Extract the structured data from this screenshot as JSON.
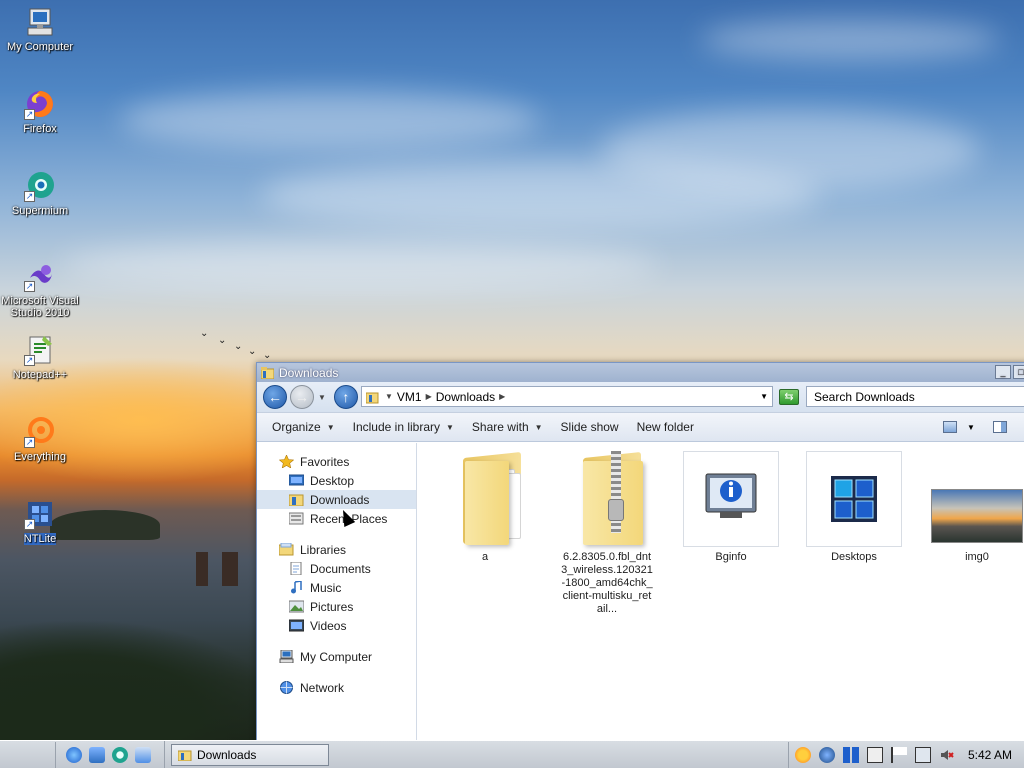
{
  "desktop": {
    "icons": [
      {
        "label": "My Computer",
        "icon": "computer-icon"
      },
      {
        "label": "Firefox",
        "icon": "firefox-icon"
      },
      {
        "label": "Supermium",
        "icon": "supermium-icon"
      },
      {
        "label": "Microsoft Visual Studio 2010",
        "icon": "visual-studio-icon"
      },
      {
        "label": "Notepad++",
        "icon": "notepadpp-icon"
      },
      {
        "label": "Everything",
        "icon": "everything-icon"
      },
      {
        "label": "NTLite",
        "icon": "ntlite-icon"
      }
    ]
  },
  "window": {
    "title": "Downloads",
    "address": {
      "root": "VM1",
      "current": "Downloads"
    },
    "search_placeholder": "Search Downloads",
    "toolbar": {
      "organize": "Organize",
      "include_in_library": "Include in library",
      "share_with": "Share with",
      "slide_show": "Slide show",
      "new_folder": "New folder"
    },
    "nav": {
      "favorites": "Favorites",
      "desktop": "Desktop",
      "downloads": "Downloads",
      "recent_places": "Recent Places",
      "libraries": "Libraries",
      "documents": "Documents",
      "music": "Music",
      "pictures": "Pictures",
      "videos": "Videos",
      "my_computer": "My Computer",
      "network": "Network"
    },
    "files": [
      {
        "name": "a",
        "type": "folder"
      },
      {
        "name": "6.2.8305.0.fbl_dnt3_wireless.120321-1800_amd64chk_client-multisku_retail...",
        "type": "zip-folder"
      },
      {
        "name": "Bginfo",
        "type": "application"
      },
      {
        "name": "Desktops",
        "type": "application"
      },
      {
        "name": "img0",
        "type": "image"
      }
    ]
  },
  "taskbar": {
    "task_label": "Downloads",
    "clock": "5:42 AM"
  },
  "colors": {
    "selection": "#d9e4f1",
    "accent_blue": "#1f58a8"
  }
}
